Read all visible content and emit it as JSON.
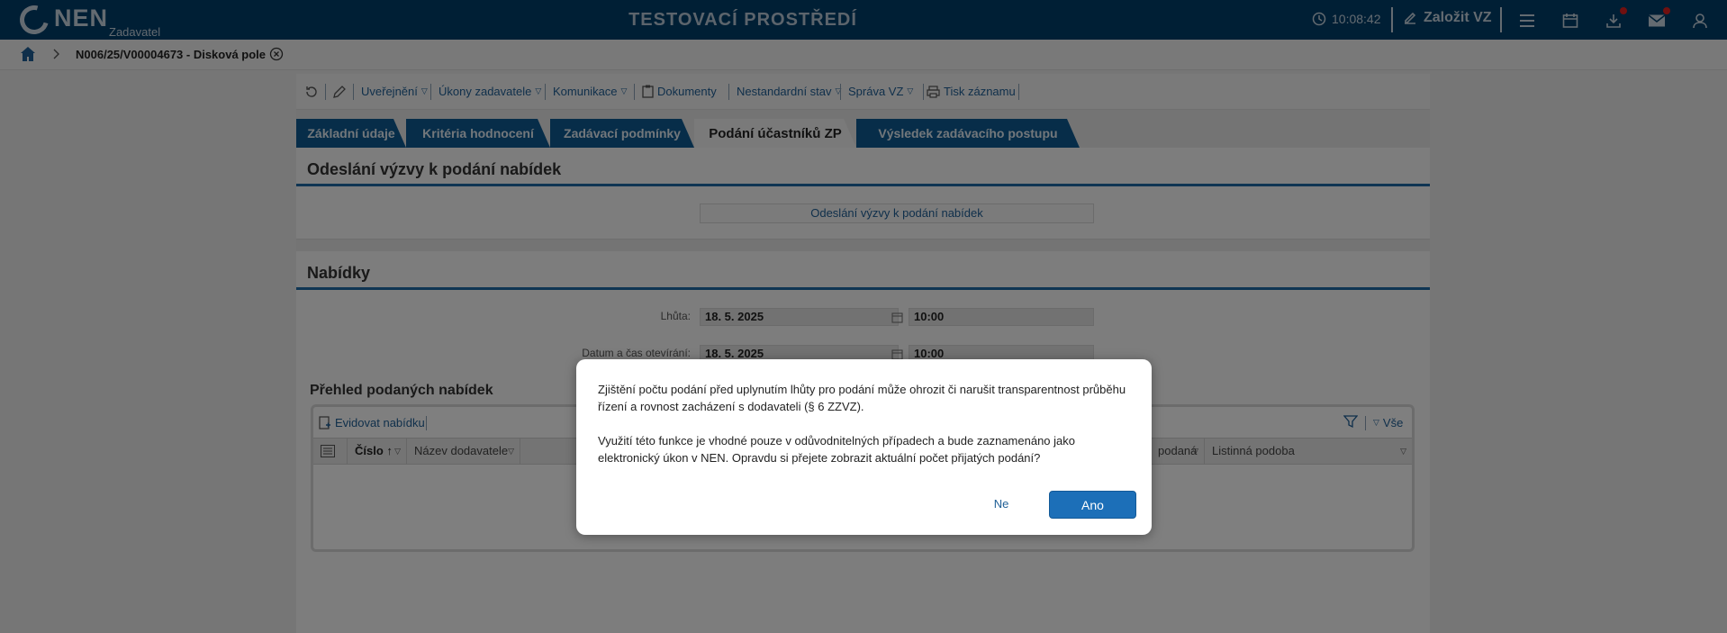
{
  "header": {
    "logo_text": "NEN",
    "logo_sub": "Zadavatel",
    "environment_title": "TESTOVACÍ PROSTŘEDÍ",
    "clock": "10:08:42",
    "create_label": "Založit VZ",
    "icons": [
      "menu-icon",
      "calendar-icon",
      "download-icon",
      "mail-icon",
      "user-icon"
    ],
    "accent_color": "#003f6b",
    "notification_color": "#e02020"
  },
  "breadcrumb": {
    "current": "N006/25/V00004673 - Disková pole"
  },
  "toolbar": {
    "items": [
      {
        "label": "Uveřejnění"
      },
      {
        "label": "Úkony zadavatele"
      },
      {
        "label": "Komunikace"
      },
      {
        "label": "Dokumenty"
      },
      {
        "label": "Nestandardní stav"
      },
      {
        "label": "Správa VZ"
      },
      {
        "label": "Tisk záznamu"
      }
    ]
  },
  "tabs": [
    {
      "label": "Základní údaje"
    },
    {
      "label": "Kritéria hodnocení"
    },
    {
      "label": "Zadávací podmínky"
    },
    {
      "label": "Podání účastníků ZP",
      "active": true
    },
    {
      "label": "Výsledek zadávacího postupu"
    }
  ],
  "section_invite": {
    "title": "Odeslání výzvy k podání nabídek",
    "button_label": "Odeslání výzvy k podání nabídek"
  },
  "section_offers": {
    "title": "Nabídky",
    "deadline_label": "Lhůta:",
    "deadline_date": "18. 5. 2025",
    "deadline_time": "10:00",
    "opening_label": "Datum a čas otevírání:",
    "opening_date": "18. 5. 2025",
    "opening_time": "10:00",
    "overview_title": "Přehled podaných nabídek",
    "register_label": "Evidovat nabídku",
    "filter_all_label": "Vše",
    "columns": [
      {
        "label": "Číslo"
      },
      {
        "label": "Název dodavatele"
      },
      {
        "label": "podaná"
      },
      {
        "label": "Listinná podoba"
      }
    ]
  },
  "dialog": {
    "paragraph1": "Zjištění počtu podání před uplynutím lhůty pro podání může ohrozit či narušit transparentnost průběhu řízení a rovnost zacházení s dodavateli (§ 6 ZZVZ).",
    "paragraph2": "Využití této funkce je vhodné pouze v odůvodnitelných případech a bude zaznamenáno jako elektronický úkon v NEN. Opravdu si přejete zobrazit aktuální počet přijatých podání?",
    "no_label": "Ne",
    "yes_label": "Ano",
    "primary_color": "#1c6fb8"
  }
}
